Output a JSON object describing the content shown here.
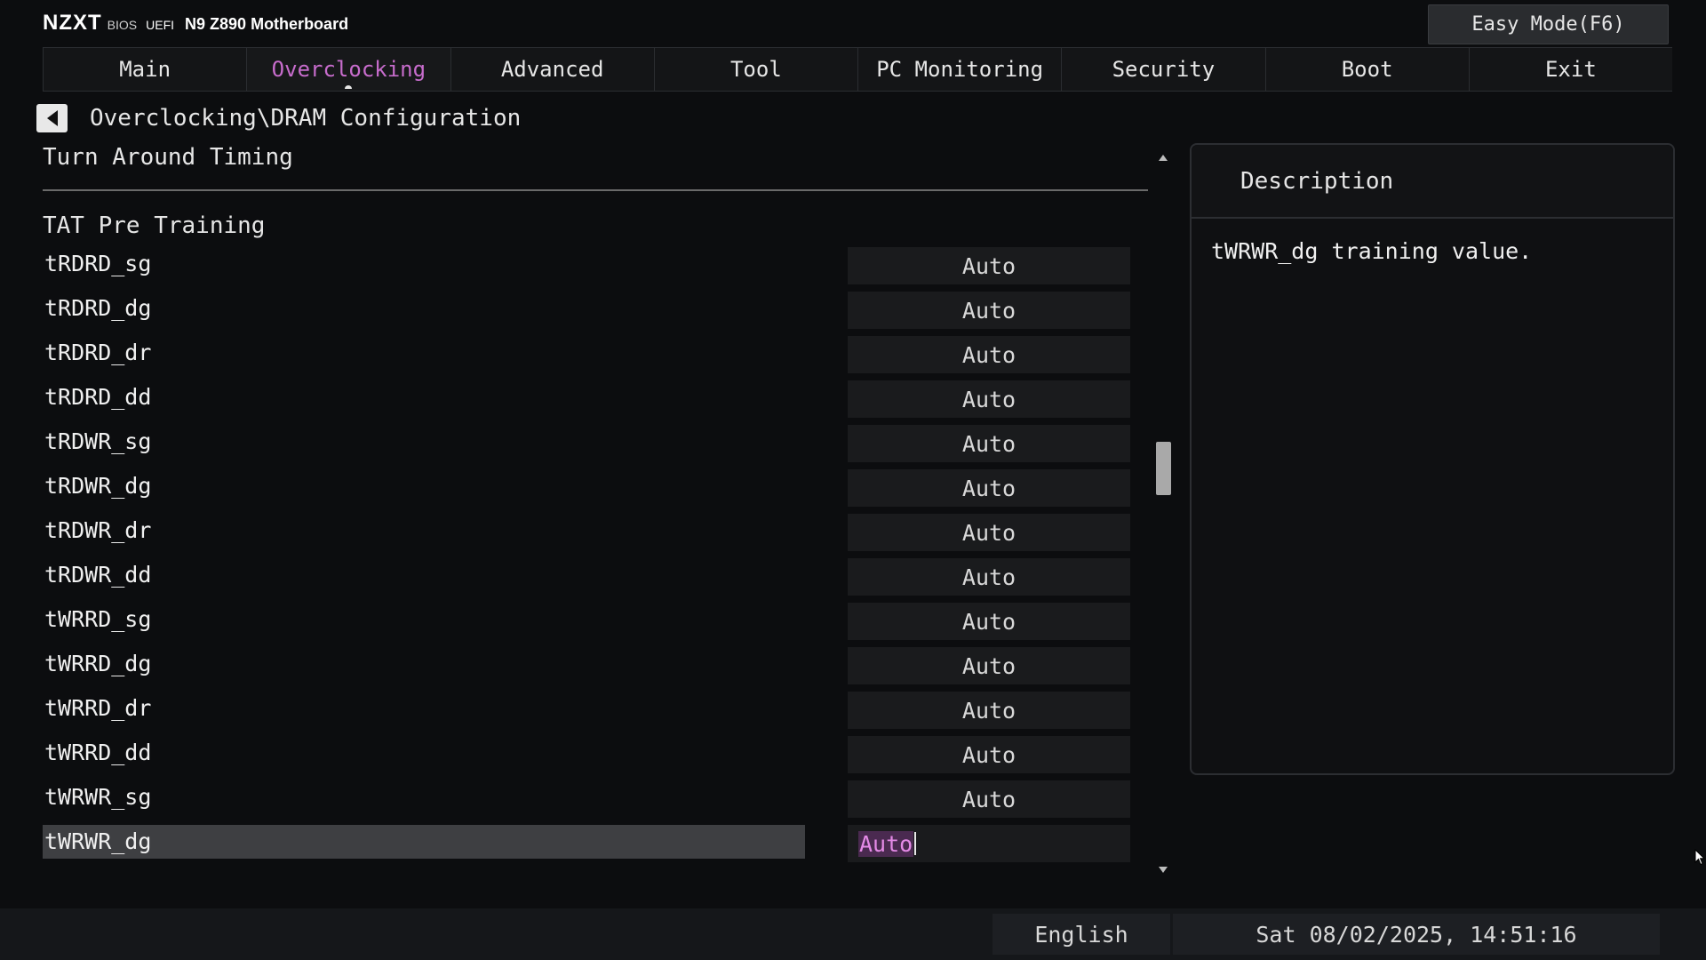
{
  "header": {
    "brand": "NZXT",
    "bios": "BIOS",
    "uefi": "UEFI",
    "model": "N9 Z890 Motherboard",
    "easy_mode": "Easy Mode(F6)"
  },
  "tabs": [
    {
      "label": "Main",
      "active": false
    },
    {
      "label": "Overclocking",
      "active": true
    },
    {
      "label": "Advanced",
      "active": false
    },
    {
      "label": "Tool",
      "active": false
    },
    {
      "label": "PC Monitoring",
      "active": false
    },
    {
      "label": "Security",
      "active": false
    },
    {
      "label": "Boot",
      "active": false
    },
    {
      "label": "Exit",
      "active": false
    }
  ],
  "breadcrumb": "Overclocking\\DRAM Configuration",
  "section_title": "Turn Around Timing",
  "sub_title": "TAT Pre Training",
  "rows": [
    {
      "label": "tRDRD_sg",
      "value": "Auto"
    },
    {
      "label": "tRDRD_dg",
      "value": "Auto"
    },
    {
      "label": "tRDRD_dr",
      "value": "Auto"
    },
    {
      "label": "tRDRD_dd",
      "value": "Auto"
    },
    {
      "label": "tRDWR_sg",
      "value": "Auto"
    },
    {
      "label": "tRDWR_dg",
      "value": "Auto"
    },
    {
      "label": "tRDWR_dr",
      "value": "Auto"
    },
    {
      "label": "tRDWR_dd",
      "value": "Auto"
    },
    {
      "label": "tWRRD_sg",
      "value": "Auto"
    },
    {
      "label": "tWRRD_dg",
      "value": "Auto"
    },
    {
      "label": "tWRRD_dr",
      "value": "Auto"
    },
    {
      "label": "tWRRD_dd",
      "value": "Auto"
    },
    {
      "label": "tWRWR_sg",
      "value": "Auto"
    },
    {
      "label": "tWRWR_dg",
      "value": "Auto",
      "selected": true
    }
  ],
  "description": {
    "title": "Description",
    "text": "tWRWR_dg training value."
  },
  "footer": {
    "language": "English",
    "datetime": "Sat 08/02/2025, 14:51:16"
  },
  "colors": {
    "accent": "#c76ccc",
    "background": "#0c0d0f"
  }
}
